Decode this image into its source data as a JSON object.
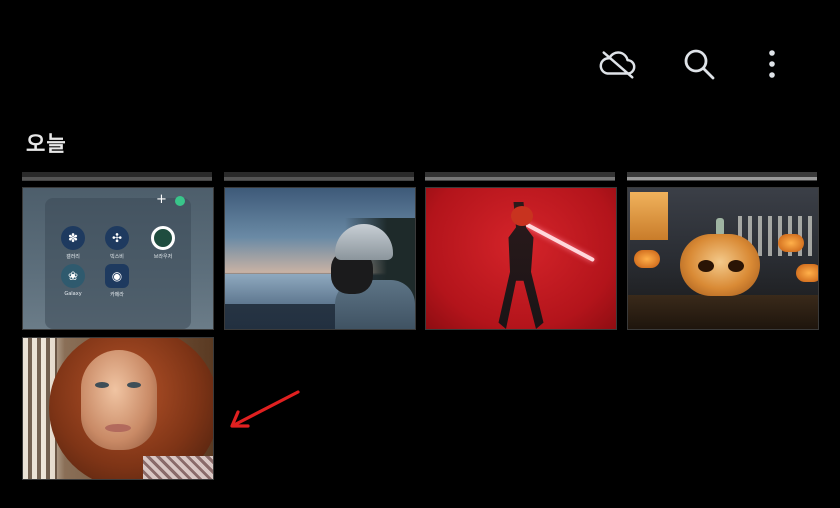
{
  "header": {
    "icons": [
      {
        "id": "cloud",
        "name": "cloud-off-icon"
      },
      {
        "id": "search",
        "name": "search-icon"
      },
      {
        "id": "more",
        "name": "more-vert-icon"
      }
    ]
  },
  "section": {
    "title": "오늘"
  },
  "thumbnails": [
    {
      "name": "home-screen-screenshot",
      "apps": [
        {
          "label": "갤러리",
          "icon": "flower-icon",
          "color": "#1e3a5f"
        },
        {
          "label": "빅스비",
          "icon": "bixby-icon",
          "color": "#1e3a5f"
        },
        {
          "label": "브라우저",
          "icon": "ring-icon",
          "color": "#1f4d3f"
        },
        {
          "label": "Galaxy",
          "icon": "leaf-icon",
          "color": "#2f5a6e"
        },
        {
          "label": "카메라",
          "icon": "camera-icon",
          "color": "#1e3a5f"
        }
      ]
    },
    {
      "name": "dusk-helmet-photo"
    },
    {
      "name": "red-warrior-photo"
    },
    {
      "name": "halloween-pumpkin-photo"
    },
    {
      "name": "red-hair-portrait-photo"
    }
  ],
  "annotation": {
    "arrow_color": "#e02020"
  }
}
